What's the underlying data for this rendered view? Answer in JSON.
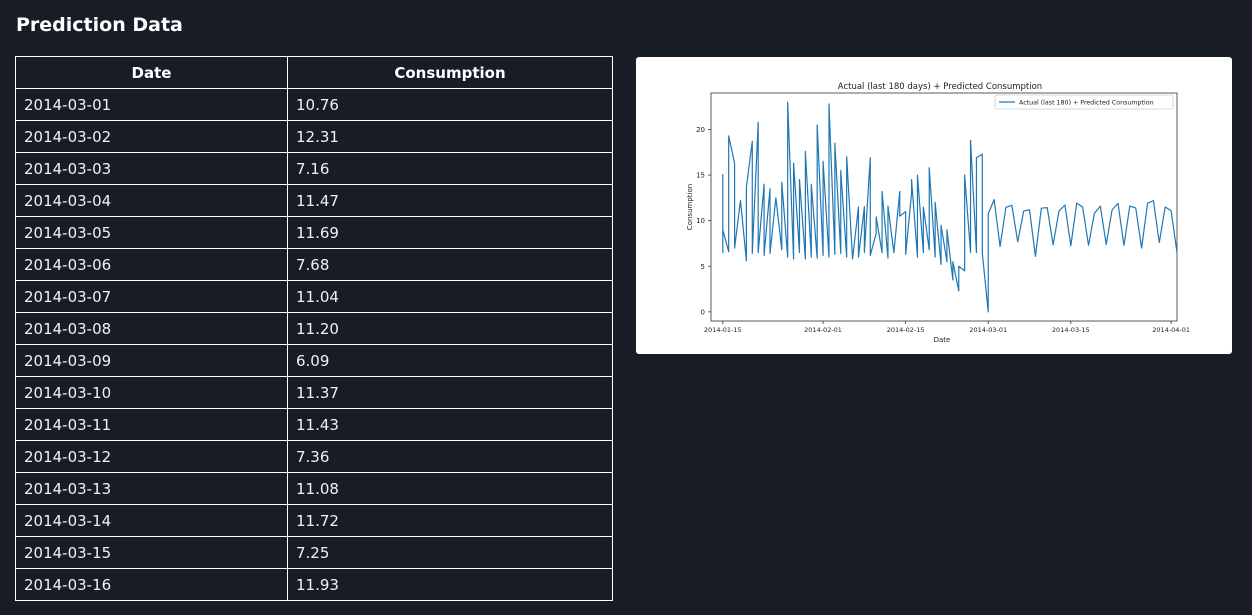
{
  "page": {
    "heading": "Prediction Data"
  },
  "table": {
    "headers": [
      "Date",
      "Consumption"
    ],
    "rows": [
      [
        "2014-03-01",
        "10.76"
      ],
      [
        "2014-03-02",
        "12.31"
      ],
      [
        "2014-03-03",
        "7.16"
      ],
      [
        "2014-03-04",
        "11.47"
      ],
      [
        "2014-03-05",
        "11.69"
      ],
      [
        "2014-03-06",
        "7.68"
      ],
      [
        "2014-03-07",
        "11.04"
      ],
      [
        "2014-03-08",
        "11.20"
      ],
      [
        "2014-03-09",
        "6.09"
      ],
      [
        "2014-03-10",
        "11.37"
      ],
      [
        "2014-03-11",
        "11.43"
      ],
      [
        "2014-03-12",
        "7.36"
      ],
      [
        "2014-03-13",
        "11.08"
      ],
      [
        "2014-03-14",
        "11.72"
      ],
      [
        "2014-03-15",
        "7.25"
      ],
      [
        "2014-03-16",
        "11.93"
      ]
    ]
  },
  "chart_data": {
    "type": "line",
    "title": "Actual (last 180 days) + Predicted Consumption",
    "xlabel": "Date",
    "ylabel": "Consumption",
    "xlim": [
      "2014-01-13",
      "2014-04-02"
    ],
    "ylim": [
      -1,
      24
    ],
    "xticks": [
      "2014-01-15",
      "2014-02-01",
      "2014-02-15",
      "2014-03-01",
      "2014-03-15",
      "2014-04-01"
    ],
    "yticks": [
      0,
      5,
      10,
      15,
      20
    ],
    "grid": false,
    "legend": "top-right",
    "line_color": "#1f77b4",
    "series": [
      {
        "name": "Actual (last 180) + Predicted Consumption",
        "points": [
          [
            "2014-01-15",
            15.1
          ],
          [
            "2014-01-15",
            6.5
          ],
          [
            "2014-01-15",
            9.0
          ],
          [
            "2014-01-16",
            6.6
          ],
          [
            "2014-01-16",
            19.3
          ],
          [
            "2014-01-17",
            16.3
          ],
          [
            "2014-01-17",
            7.0
          ],
          [
            "2014-01-18",
            12.2
          ],
          [
            "2014-01-19",
            5.6
          ],
          [
            "2014-01-19",
            13.7
          ],
          [
            "2014-01-20",
            18.7
          ],
          [
            "2014-01-20",
            6.4
          ],
          [
            "2014-01-21",
            20.8
          ],
          [
            "2014-01-21",
            6.5
          ],
          [
            "2014-01-22",
            14.0
          ],
          [
            "2014-01-22",
            6.2
          ],
          [
            "2014-01-23",
            13.5
          ],
          [
            "2014-01-23",
            6.4
          ],
          [
            "2014-01-24",
            12.5
          ],
          [
            "2014-01-25",
            6.8
          ],
          [
            "2014-01-25",
            14.2
          ],
          [
            "2014-01-26",
            6.0
          ],
          [
            "2014-01-26",
            23.0
          ],
          [
            "2014-01-27",
            5.8
          ],
          [
            "2014-01-27",
            16.3
          ],
          [
            "2014-01-28",
            6.5
          ],
          [
            "2014-01-28",
            14.5
          ],
          [
            "2014-01-29",
            5.8
          ],
          [
            "2014-01-29",
            17.6
          ],
          [
            "2014-01-30",
            6.0
          ],
          [
            "2014-01-30",
            14.0
          ],
          [
            "2014-01-31",
            5.9
          ],
          [
            "2014-01-31",
            20.5
          ],
          [
            "2014-02-01",
            6.2
          ],
          [
            "2014-02-01",
            16.5
          ],
          [
            "2014-02-02",
            6.0
          ],
          [
            "2014-02-02",
            22.8
          ],
          [
            "2014-02-03",
            6.3
          ],
          [
            "2014-02-03",
            18.5
          ],
          [
            "2014-02-04",
            6.4
          ],
          [
            "2014-02-04",
            15.5
          ],
          [
            "2014-02-05",
            6.0
          ],
          [
            "2014-02-05",
            17.0
          ],
          [
            "2014-02-06",
            5.8
          ],
          [
            "2014-02-07",
            11.5
          ],
          [
            "2014-02-07",
            6.0
          ],
          [
            "2014-02-08",
            11.5
          ],
          [
            "2014-02-08",
            6.5
          ],
          [
            "2014-02-09",
            16.9
          ],
          [
            "2014-02-09",
            6.2
          ],
          [
            "2014-02-10",
            8.6
          ],
          [
            "2014-02-10",
            10.4
          ],
          [
            "2014-02-11",
            6.5
          ],
          [
            "2014-02-11",
            13.2
          ],
          [
            "2014-02-12",
            5.9
          ],
          [
            "2014-02-12",
            11.6
          ],
          [
            "2014-02-13",
            6.5
          ],
          [
            "2014-02-14",
            13.2
          ],
          [
            "2014-02-14",
            10.5
          ],
          [
            "2014-02-15",
            11.0
          ],
          [
            "2014-02-15",
            6.3
          ],
          [
            "2014-02-16",
            13.0
          ],
          [
            "2014-02-16",
            14.5
          ],
          [
            "2014-02-17",
            6.0
          ],
          [
            "2014-02-17",
            15.0
          ],
          [
            "2014-02-18",
            6.5
          ],
          [
            "2014-02-18",
            11.5
          ],
          [
            "2014-02-19",
            6.8
          ],
          [
            "2014-02-19",
            15.8
          ],
          [
            "2014-02-20",
            6.0
          ],
          [
            "2014-02-20",
            12.0
          ],
          [
            "2014-02-21",
            5.2
          ],
          [
            "2014-02-21",
            9.5
          ],
          [
            "2014-02-22",
            5.5
          ],
          [
            "2014-02-22",
            9.0
          ],
          [
            "2014-02-23",
            3.5
          ],
          [
            "2014-02-23",
            5.5
          ],
          [
            "2014-02-24",
            2.3
          ],
          [
            "2014-02-24",
            5.0
          ],
          [
            "2014-02-25",
            4.5
          ],
          [
            "2014-02-25",
            15.0
          ],
          [
            "2014-02-26",
            6.5
          ],
          [
            "2014-02-26",
            18.8
          ],
          [
            "2014-02-27",
            6.5
          ],
          [
            "2014-02-27",
            16.9
          ],
          [
            "2014-02-28",
            17.3
          ],
          [
            "2014-02-28",
            6.4
          ],
          [
            "2014-03-01",
            0.0
          ],
          [
            "2014-03-01",
            10.76
          ],
          [
            "2014-03-02",
            12.31
          ],
          [
            "2014-03-03",
            7.16
          ],
          [
            "2014-03-04",
            11.47
          ],
          [
            "2014-03-05",
            11.69
          ],
          [
            "2014-03-06",
            7.68
          ],
          [
            "2014-03-07",
            11.04
          ],
          [
            "2014-03-08",
            11.2
          ],
          [
            "2014-03-09",
            6.09
          ],
          [
            "2014-03-10",
            11.37
          ],
          [
            "2014-03-11",
            11.43
          ],
          [
            "2014-03-12",
            7.36
          ],
          [
            "2014-03-13",
            11.08
          ],
          [
            "2014-03-14",
            11.72
          ],
          [
            "2014-03-15",
            7.25
          ],
          [
            "2014-03-16",
            11.93
          ],
          [
            "2014-03-17",
            11.5
          ],
          [
            "2014-03-18",
            7.3
          ],
          [
            "2014-03-19",
            10.8
          ],
          [
            "2014-03-20",
            11.6
          ],
          [
            "2014-03-21",
            7.4
          ],
          [
            "2014-03-22",
            11.2
          ],
          [
            "2014-03-23",
            11.9
          ],
          [
            "2014-03-24",
            7.3
          ],
          [
            "2014-03-25",
            11.6
          ],
          [
            "2014-03-26",
            11.4
          ],
          [
            "2014-03-27",
            7.0
          ],
          [
            "2014-03-28",
            11.9
          ],
          [
            "2014-03-29",
            12.2
          ],
          [
            "2014-03-30",
            7.6
          ],
          [
            "2014-03-31",
            11.5
          ],
          [
            "2014-04-01",
            11.1
          ],
          [
            "2014-04-02",
            6.5
          ]
        ]
      }
    ]
  }
}
